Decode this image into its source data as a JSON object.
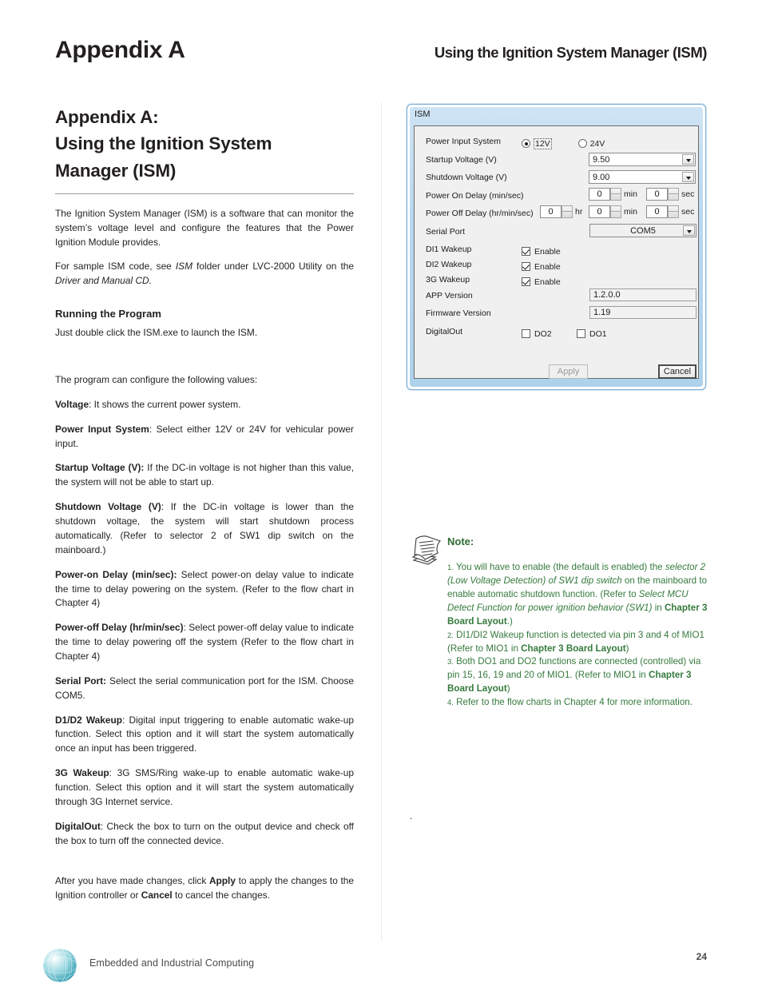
{
  "header": {
    "left": "Appendix A",
    "right": "Using the Ignition System Manager (ISM)"
  },
  "left_column": {
    "title_line1": "Appendix A:",
    "title_line2": "Using the Ignition System",
    "title_line3": "Manager (ISM)",
    "intro_p1": "The Ignition System Manager (ISM) is a software that can monitor the system’s voltage level and configure the features that the Power Ignition Module provides.",
    "intro_p2_a": "For sample ISM code, see ",
    "intro_p2_i1": "ISM",
    "intro_p2_b": " folder under LVC-2000 Utility on the ",
    "intro_p2_i2": "Driver and Manual CD.",
    "subhead_running": "Running the Program",
    "running_body": "Just double click the ISM.exe to launch the ISM.",
    "configure_intro": "The program can configure the following values:",
    "items": [
      {
        "term": "Voltage",
        "body": ": It shows the current power system."
      },
      {
        "term": "Power Input System",
        "body": ": Select either 12V or 24V for vehicular power input."
      },
      {
        "term": "Startup Voltage (V):",
        "body": "  If the DC-in voltage is not higher than this value, the system will not be able to start up."
      },
      {
        "term": "Shutdown Voltage (V)",
        "body": ": If the DC-in voltage is lower than the shutdown voltage, the system will start shutdown process automatically. (Refer to selector 2 of SW1 dip switch on the mainboard.)"
      },
      {
        "term": "Power-on Delay (min/sec):",
        "body": " Select power-on delay value to indicate the time to delay powering on the system. (Refer to the flow chart in Chapter 4)"
      },
      {
        "term": "Power-off Delay (hr/min/sec)",
        "body": ": Select power-off delay value to indicate the time to delay powering off the system (Refer to the flow chart in Chapter 4)"
      },
      {
        "term": "Serial Port:",
        "body": " Select the serial communication port for the ISM. Choose COM5."
      },
      {
        "term": "D1/D2 Wakeup",
        "body": ": Digital input triggering to enable automatic wake-up function. Select this option and it will start the system automatically once an input has been triggered."
      },
      {
        "term": "3G Wakeup",
        "body": ": 3G SMS/Ring wake-up to enable automatic wake-up function.  Select this option and it will start the system automatically through 3G Internet service."
      },
      {
        "term": "DigitalOut",
        "body": ":  Check the box to turn on the output device and check off the box to turn off the connected device."
      }
    ],
    "closing_a": "After you have made changes, click ",
    "closing_b1": "Apply",
    "closing_c": " to apply the changes to the Ignition controller or ",
    "closing_b2": "Cancel",
    "closing_d": " to cancel the changes."
  },
  "ism_dialog": {
    "title": "ISM",
    "power_input_system": {
      "label": "Power Input System",
      "option_12v": "12V",
      "option_24v": "24V",
      "selected": "12V"
    },
    "startup_voltage": {
      "label": "Startup Voltage (V)",
      "value": "9.50"
    },
    "shutdown_voltage": {
      "label": "Shutdown Voltage (V)",
      "value": "9.00"
    },
    "power_on_delay": {
      "label": "Power On Delay (min/sec)",
      "min_value": "0",
      "min_unit": "min",
      "sec_value": "0",
      "sec_unit": "sec"
    },
    "power_off_delay": {
      "label": "Power Off Delay (hr/min/sec)",
      "hr_value": "0",
      "hr_unit": "hr",
      "min_value": "0",
      "min_unit": "min",
      "sec_value": "0",
      "sec_unit": "sec"
    },
    "serial_port": {
      "label": "Serial Port",
      "value": "COM5"
    },
    "di1_wakeup": {
      "label": "DI1 Wakeup",
      "checkbox_label": "Enable",
      "checked": true
    },
    "di2_wakeup": {
      "label": "DI2 Wakeup",
      "checkbox_label": "Enable",
      "checked": true
    },
    "tg_wakeup": {
      "label": "3G Wakeup",
      "checkbox_label": "Enable",
      "checked": true
    },
    "app_version": {
      "label": "APP Version",
      "value": "1.2.0.0"
    },
    "firmware_version": {
      "label": "Firmware Version",
      "value": "1.19"
    },
    "digital_out": {
      "label": "DigitalOut",
      "do2_label": "DO2",
      "do2_checked": false,
      "do1_label": "DO1",
      "do1_checked": false
    },
    "apply_button": "Apply",
    "cancel_button": "Cancel"
  },
  "note": {
    "title": "Note:",
    "item1": {
      "num": "1.",
      "t1": " You will have to enable (the default is enabled) the ",
      "i1": "selector 2 (Low Voltage Detection) of SW1 dip switch",
      "t2": " on the mainboard to enable automatic shutdown function. (Refer to ",
      "i2": "Select MCU Detect Function for power ignition behavior (SW1)",
      "t3": " in ",
      "b1": "Chapter 3 Board Layout",
      "t4": ".)"
    },
    "item2": {
      "num": "2.",
      "t1": " DI1/DI2 Wakeup function is detected via pin 3 and 4 of MIO1 (Refer to MIO1 in ",
      "b1": "Chapter 3 Board Layout",
      "t2": ")"
    },
    "item3": {
      "num": "3.",
      "t1": "  Both DO1 and DO2 functions are connected (controlled) via pin 15, 16, 19 and 20 of MIO1. (Refer to MIO1 in ",
      "b1": "Chapter 3 Board Layout",
      "t2": ")"
    },
    "item4": {
      "num": "4.",
      "t1": "  Refer to the flow charts in Chapter 4 for more information."
    },
    "trailing_dot": "."
  },
  "footer": {
    "tagline": "Embedded and Industrial Computing",
    "page_number": "24"
  },
  "colors": {
    "note_green": "#357a3d",
    "note_green_dark": "#2c6b33",
    "logo_teal": "#27a3b8",
    "divider": "#e7ebf5",
    "dialog_border": "#7aaed6"
  }
}
